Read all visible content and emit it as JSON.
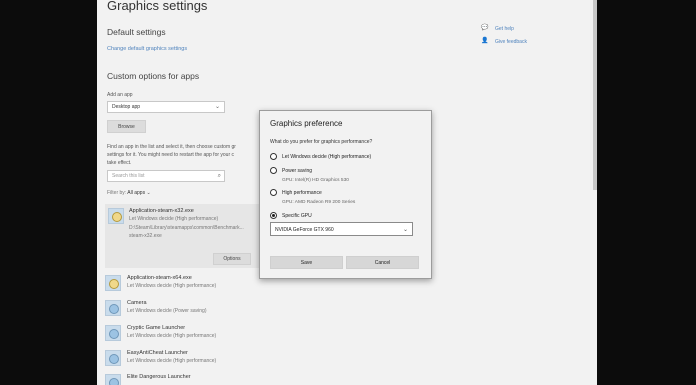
{
  "settings": {
    "title": "Graphics settings",
    "default_heading": "Default settings",
    "default_link": "Change default graphics settings",
    "custom_heading": "Custom options for apps",
    "add_app_label": "Add an app",
    "app_type_value": "Desktop app",
    "browse_label": "Browse",
    "instructions_lines": [
      "Find an app in the list and select it, then choose custom gr",
      "settings for it. You might need to restart the app for your c",
      "take effect."
    ],
    "search_placeholder": "Search this list",
    "filter_label": "Filter by:",
    "filter_value": "All apps",
    "selected_app": {
      "name": "Application-steam-x32.exe",
      "status": "Let Windows decide (High performance)",
      "path_lines": [
        "D:\\Steam\\Library\\steamapps\\common\\Benchmark...",
        "steam-x32.exe"
      ],
      "options_label": "Options"
    },
    "apps": [
      {
        "name": "Application-steam-x64.exe",
        "status": "Let Windows decide (High performance)"
      },
      {
        "name": "Camera",
        "status": "Let Windows decide (Power saving)"
      },
      {
        "name": "Cryptic Game Launcher",
        "status": "Let Windows decide (High performance)"
      },
      {
        "name": "EasyAntiCheat Launcher",
        "status": "Let Windows decide (High performance)"
      },
      {
        "name": "Elite Dangerous Launcher",
        "status": ""
      }
    ],
    "side_links": {
      "help": "Get help",
      "feedback": "Give feedback"
    }
  },
  "dialog": {
    "title": "Graphics preference",
    "question": "What do you prefer for graphics performance?",
    "options": [
      {
        "label": "Let Windows decide (High performance)",
        "sub": ""
      },
      {
        "label": "Power saving",
        "sub": "GPU: Intel(R) HD Graphics 530"
      },
      {
        "label": "High performance",
        "sub": "GPU: AMD Radeon R9 200 Series"
      },
      {
        "label": "Specific GPU",
        "sub": ""
      }
    ],
    "selected_option": "Specific GPU",
    "gpu_value": "NVIDIA GeForce GTX 960",
    "save_label": "Save",
    "cancel_label": "Cancel"
  },
  "colors": {
    "accent": "#4f83bd",
    "backdrop": "#0c0c0c",
    "panel": "#f2f2f2"
  }
}
